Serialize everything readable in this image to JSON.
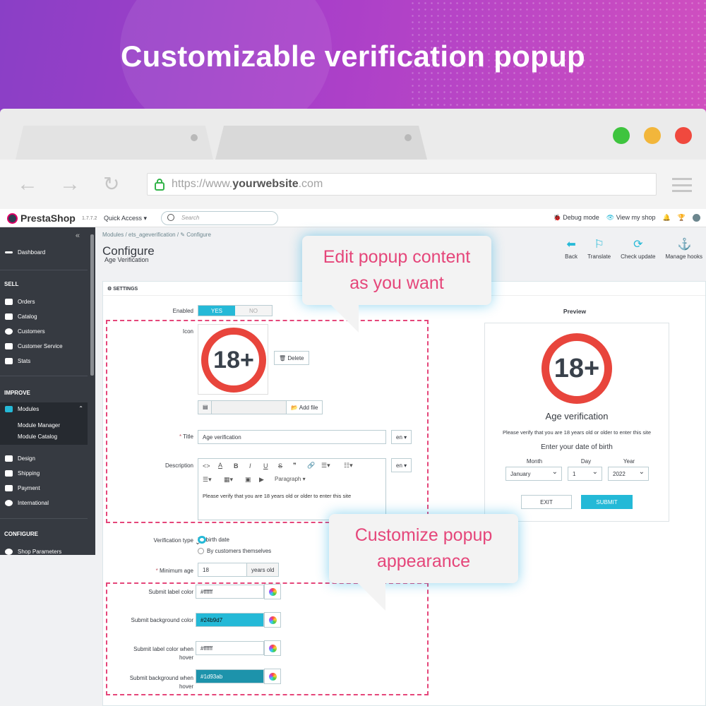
{
  "banner": {
    "title": "Customizable verification popup"
  },
  "browser": {
    "url_prefix": "https://www.",
    "url_domain": "yourwebsite",
    "url_suffix": ".com",
    "lights": [
      "#3ec43e",
      "#f2b63b",
      "#f0493e"
    ]
  },
  "topbar": {
    "brand": "PrestaShop",
    "version": "1.7.7.2",
    "quick_access": "Quick Access ▾",
    "search_placeholder": "Search",
    "debug": "Debug mode",
    "view_shop": "View my shop"
  },
  "sidebar": {
    "dashboard": "Dashboard",
    "sell": "SELL",
    "orders": "Orders",
    "catalog": "Catalog",
    "customers": "Customers",
    "customer_service": "Customer Service",
    "stats": "Stats",
    "improve": "IMPROVE",
    "modules": "Modules",
    "module_manager": "Module Manager",
    "module_catalog": "Module Catalog",
    "design": "Design",
    "shipping": "Shipping",
    "payment": "Payment",
    "international": "International",
    "configure": "CONFIGURE",
    "shop_parameters": "Shop Parameters"
  },
  "page": {
    "breadcrumb": "Modules  /  ets_ageverification  /  ✎ Configure",
    "title": "Configure",
    "subtitle": "Age Verification",
    "toolbar": {
      "back": "Back",
      "translate": "Translate",
      "check_update": "Check update",
      "manage_hooks": "Manage hooks"
    }
  },
  "settings": {
    "header": "⚙ SETTINGS",
    "enabled_label": "Enabled",
    "yes": "YES",
    "no": "NO",
    "icon_label": "Icon",
    "icon_text": "18+",
    "delete": "🗑 Delete",
    "add_file": "📂 Add file",
    "title_label": "Title",
    "title_value": "Age verification",
    "lang": "en ▾",
    "description_label": "Description",
    "paragraph": "Paragraph ▾",
    "description_value": "Please verify that you are 18 years old or older to enter this site",
    "verification_type_label": "Verification type",
    "vt_option1": "By birth date",
    "vt_option2": "By customers themselves",
    "min_age_label": "Minimum age",
    "min_age_value": "18",
    "min_age_unit": "years old",
    "submit_label_color_label": "Submit label color",
    "submit_label_color": "#ffffff",
    "submit_bg_label": "Submit background color",
    "submit_bg_color": "#24b9d7",
    "submit_label_hover_label1": "Submit label color when",
    "submit_label_hover_label2": "hover",
    "submit_label_hover_color": "#ffffff",
    "submit_bg_hover_label1": "Submit background when",
    "submit_bg_hover_label2": "hover",
    "submit_bg_hover_color": "#1d93ab"
  },
  "preview": {
    "heading": "Preview",
    "icon_text": "18+",
    "title": "Age verification",
    "message": "Please verify that you are 18 years old or older to enter this site",
    "dob_heading": "Enter your date of birth",
    "month_label": "Month",
    "day_label": "Day",
    "year_label": "Year",
    "month_value": "January",
    "day_value": "1",
    "year_value": "2022",
    "exit": "EXIT",
    "submit": "SUBMIT"
  },
  "callouts": {
    "edit_line1": "Edit popup content",
    "edit_line2": "as you want",
    "custom_line1": "Customize popup",
    "custom_line2": "appearance"
  },
  "colors": {
    "accent": "#25b9d7",
    "callout_text": "#e5467a",
    "sign_red": "#e8453c"
  }
}
